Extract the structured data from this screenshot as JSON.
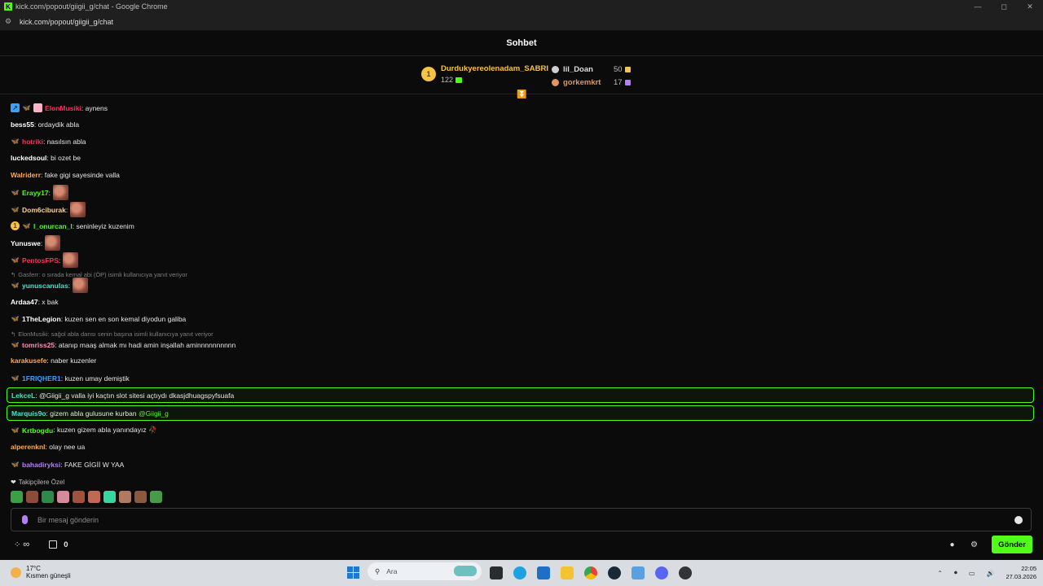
{
  "browser": {
    "title": "kick.com/popout/giigii_g/chat - Google Chrome",
    "url": "kick.com/popout/giigii_g/chat",
    "window_buttons": [
      "—",
      "◻",
      "✕"
    ]
  },
  "chat": {
    "title": "Sohbet",
    "leaderboard": {
      "first": {
        "rank": "1",
        "name": "Durdukyereolenadam_SABRI",
        "points": "122"
      },
      "second": {
        "name": "lil_Doan",
        "points": "50"
      },
      "third": {
        "name": "gorkemkrt",
        "points": "17"
      }
    },
    "messages": [
      {
        "user": "ElonMusiki",
        "color": "#ff2d55",
        "text": ": aynens",
        "badges": [
          "blue",
          "butterfly-orange",
          "gift"
        ]
      },
      {
        "user": "bess55",
        "color": "#ffffff",
        "text": ": ordaydik abla",
        "badges": []
      },
      {
        "user": "hotriki",
        "color": "#ff2d55",
        "text": ": nasılsın abla",
        "badges": [
          "butterfly"
        ]
      },
      {
        "user": "luckedsoul",
        "color": "#ffffff",
        "text": ": bi ozet be",
        "badges": []
      },
      {
        "user": "Walriderr",
        "color": "#ffa94d",
        "text": ": fake gigi sayesinde valla",
        "badges": []
      },
      {
        "user": "Erayy17",
        "color": "#53fc18",
        "text": ":",
        "badges": [
          "butterfly-orange"
        ],
        "emote": true
      },
      {
        "user": "Dom6ciburak",
        "color": "#ffd08a",
        "text": ":",
        "badges": [
          "butterfly"
        ],
        "emote": true
      },
      {
        "user": "l_onurcan_l",
        "color": "#53fc18",
        "text": ": seninleyiz kuzenim",
        "badges": [
          "one",
          "butterfly"
        ]
      },
      {
        "user": "Yunuswe",
        "color": "#ffffff",
        "text": ":",
        "badges": [],
        "emote": true
      },
      {
        "user": "PentosFPS",
        "color": "#ff2d55",
        "text": ":",
        "badges": [
          "butterfly"
        ],
        "emote": true
      },
      {
        "user": "yunuscanulas",
        "color": "#4de0c9",
        "text": ":",
        "badges": [
          "butterfly"
        ],
        "emote": true,
        "reply": "Gasferr: o sırada kemal abi (ÖP) isimli kullanıcıya yanıt veriyor"
      },
      {
        "user": "Ardaa47",
        "color": "#ffffff",
        "text": ": x bak",
        "badges": []
      },
      {
        "user": "1TheLegion",
        "color": "#ffffff",
        "text": ": kuzen sen en son kemal diyodun galiba",
        "badges": [
          "butterfly"
        ]
      },
      {
        "user": "tomriss25",
        "color": "#ff8fb0",
        "text": ": atanıp maaş almak mı hadi amin inşallah aminnnnnnnnnn",
        "badges": [
          "butterfly-orange"
        ],
        "reply": "ElonMusiki: sağol abla darısı senin başına isimli kullanıcıya yanıt veriyor"
      },
      {
        "user": "karakusefe",
        "color": "#ffa94d",
        "text": ": naber kuzenler",
        "badges": []
      },
      {
        "user": "1FRIQHER1",
        "color": "#3aa0ff",
        "text": ": kuzen umay demiştik",
        "badges": [
          "butterfly"
        ]
      },
      {
        "user": "LekceL",
        "color": "#4de0c9",
        "text": ": @Giigii_g valla iyi kaçtın slot sitesi açtıydı dkasjdhuagspyfsuafa",
        "badges": [],
        "highlight": true,
        "mention": "@Giigii_g"
      },
      {
        "user": "Marquis9o",
        "color": "#e6e6e6",
        "text": ": gizem abla gulusune kurban",
        "badges": [],
        "highlight": true,
        "mention_after": "@Giigii_g"
      },
      {
        "user": "Krtbogdu",
        "color": "#53fc18",
        "text": ": kuzen gizem abla yanındayız 🥀",
        "badges": [
          "butterfly"
        ]
      },
      {
        "user": "alperenknl",
        "color": "#ffa94d",
        "text": ": olay nee ua",
        "badges": []
      },
      {
        "user": "bahadiryksi",
        "color": "#b77cff",
        "text": ": FAKE GİGİİ W YAA",
        "badges": [
          "butterfly"
        ]
      }
    ],
    "followers_label": "Takipçilere Özel",
    "input_placeholder": "Bir mesaj gönderin",
    "points_label": "0",
    "send_label": "Gönder"
  },
  "taskbar": {
    "weather_temp": "17°C",
    "weather_desc": "Kısmen güneşli",
    "search_placeholder": "Ara",
    "time": "22:05",
    "date": "27.03.2026"
  }
}
